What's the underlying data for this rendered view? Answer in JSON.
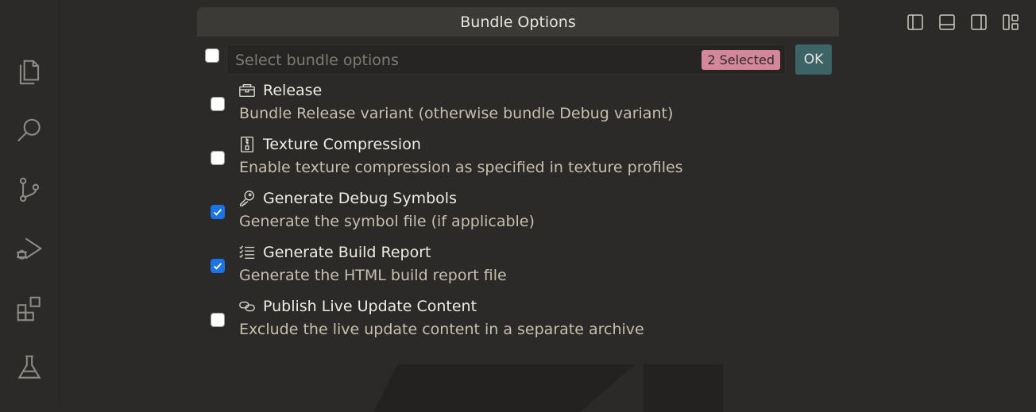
{
  "quick_pick": {
    "title": "Bundle Options",
    "placeholder": "Select bundle options",
    "selected_badge": "2 Selected",
    "ok_label": "OK",
    "items": [
      {
        "label": "Release",
        "description": "Bundle Release variant (otherwise bundle Debug variant)",
        "checked": false,
        "icon": "package-icon"
      },
      {
        "label": "Texture Compression",
        "description": "Enable texture compression as specified in texture profiles",
        "checked": false,
        "icon": "file-zip-icon"
      },
      {
        "label": "Generate Debug Symbols",
        "description": "Generate the symbol file (if applicable)",
        "checked": true,
        "icon": "key-icon"
      },
      {
        "label": "Generate Build Report",
        "description": "Generate the HTML build report file",
        "checked": true,
        "icon": "checklist-icon"
      },
      {
        "label": "Publish Live Update Content",
        "description": "Exclude the live update content in a separate archive",
        "checked": false,
        "icon": "link-icon"
      }
    ]
  },
  "activity_bar": [
    "explorer-icon",
    "search-icon",
    "source-control-icon",
    "run-debug-icon",
    "extensions-icon",
    "testing-icon"
  ],
  "layout_controls": [
    "toggle-primary-sidebar-icon",
    "toggle-panel-icon",
    "toggle-secondary-sidebar-icon",
    "customize-layout-icon"
  ],
  "colors": {
    "background": "#2b2a28",
    "title_bar": "#3b3a37",
    "badge": "#d4869b",
    "ok_button": "#3c6466",
    "checkbox_checked": "#1a73e8",
    "description_text": "#c8bfae"
  }
}
